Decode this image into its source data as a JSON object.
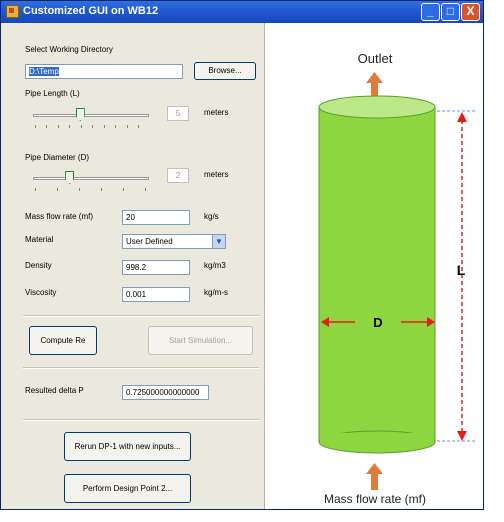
{
  "window": {
    "title": "Customized GUI on WB12"
  },
  "titlebar_buttons": {
    "minimize": "_",
    "maximize": "□",
    "close": "X"
  },
  "form": {
    "working_dir_label": "Select Working Directory",
    "working_dir_value": "D:\\Temp",
    "browse_button": "Browse...",
    "pipe_length_label": "Pipe Length (L)",
    "pipe_length_value": "5",
    "pipe_length_unit": "meters",
    "pipe_length_slider": 0.4,
    "pipe_diameter_label": "Pipe Diameter (D)",
    "pipe_diameter_value": "2",
    "pipe_diameter_unit": "meters",
    "pipe_diameter_slider": 0.3,
    "mass_flow_label": "Mass flow rate (mf)",
    "mass_flow_value": "20",
    "mass_flow_unit": "kg/s",
    "material_label": "Material",
    "material_value": "User Defined",
    "density_label": "Density",
    "density_value": "998.2",
    "density_unit": "kg/m3",
    "viscosity_label": "Viscosity",
    "viscosity_value": "0.001",
    "viscosity_unit": "kg/m-s",
    "compute_button": "Compute Re",
    "start_sim_button": "Start Simulation...",
    "result_label": "Resulted delta P",
    "result_value": "0.725000000000000",
    "rerun_button": "Rerun DP-1 with new inputs...",
    "perform_button": "Perform Design Point 2..."
  },
  "diagram": {
    "outlet_label": "Outlet",
    "length_label": "L",
    "diameter_label": "D",
    "inlet_label": "Mass flow rate (mf)",
    "colors": {
      "pipe": "#8dd640",
      "pipe_top": "#bde88a",
      "arrow": "#e07b39",
      "dim": "#e02020"
    }
  }
}
